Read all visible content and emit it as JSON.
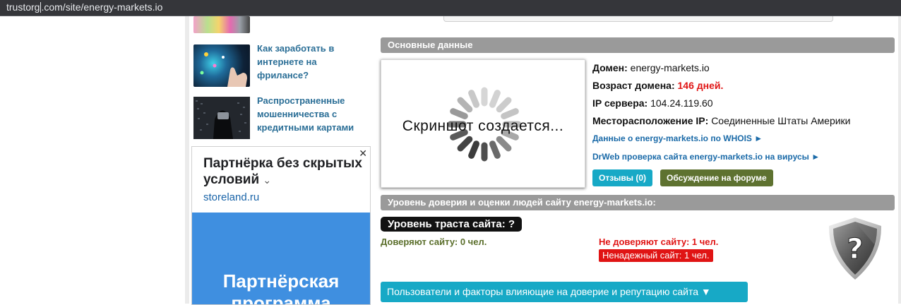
{
  "browser": {
    "url_prefix": "trustorg",
    "url_suffix": ".com/site/energy-markets.io"
  },
  "sidebar": {
    "articles": [
      {
        "title": "Как заработать в интернете на фрилансе?"
      },
      {
        "title": "Распространенные мошенничества с кредитными картами"
      }
    ],
    "ad": {
      "close_glyph": "✕",
      "title": "Партнёрка без скрытых условий",
      "domain": "storeland.ru",
      "banner_text": "Партнёрская программа"
    }
  },
  "main_data": {
    "header": "Основные данные",
    "screenshot_text": "Скриншот создается...",
    "domain_label": "Домен:",
    "domain_value": "energy-markets.io",
    "age_label": "Возраст домена:",
    "age_value": "146 дней.",
    "ip_label": "IP сервера:",
    "ip_value": "104.24.119.60",
    "location_label": "Месторасположение IP:",
    "location_value": "Соединенные Штаты Америки",
    "whois_link": "Данные о energy-markets.io по WHOIS ►",
    "drweb_link": "DrWeb проверка сайта energy-markets.io на вирусы ►",
    "reviews_button": "Отзывы (0)",
    "forum_button": "Обсуждение на форуме"
  },
  "trust": {
    "header": "Уровень доверия и оценки людей сайту energy-markets.io:",
    "level": "Уровень траста сайта: ?",
    "trust_count": "Доверяют сайту: 0 чел.",
    "distrust_count": "Не доверяют сайту: 1 чел.",
    "unreliable": "Ненадежный сайт: 1 чел.",
    "factors_button": "Пользователи и факторы влияющие на доверие и репутацию сайта ▼",
    "shield_symbol": "?"
  },
  "colors": {
    "link": "#2a6e96",
    "header_gray": "#9a9a9a",
    "reviews_btn": "#17a9c6",
    "forum_btn": "#5e7230",
    "danger": "#e01414",
    "trust_ok": "#5a6e2a"
  }
}
